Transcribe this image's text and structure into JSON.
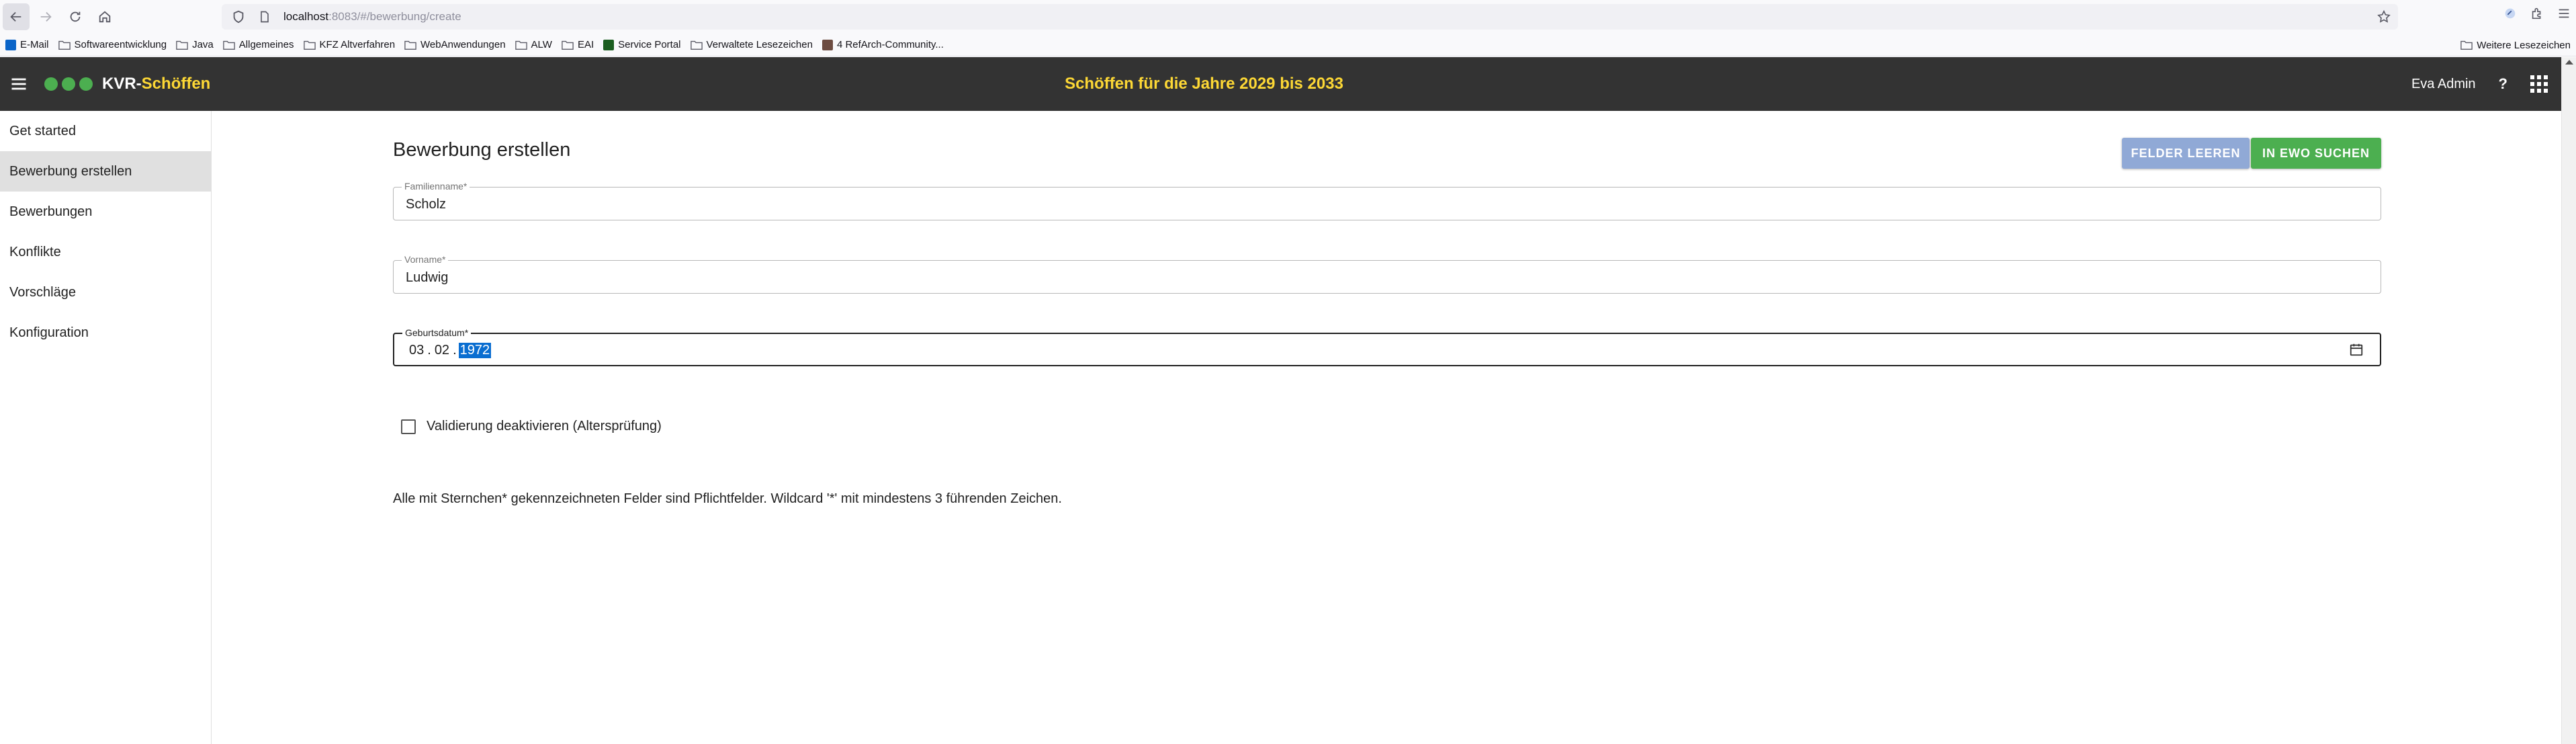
{
  "browser": {
    "url_host": "localhost",
    "url_rest": ":8083/#/bewerbung/create",
    "bookmarks": [
      {
        "label": "E-Mail",
        "type": "favicon",
        "color": "#0a64c8"
      },
      {
        "label": "Softwareentwicklung",
        "type": "folder"
      },
      {
        "label": "Java",
        "type": "folder"
      },
      {
        "label": "Allgemeines",
        "type": "folder"
      },
      {
        "label": "KFZ Altverfahren",
        "type": "folder"
      },
      {
        "label": "WebAnwendungen",
        "type": "folder"
      },
      {
        "label": "ALW",
        "type": "folder"
      },
      {
        "label": "EAI",
        "type": "folder"
      },
      {
        "label": "Service Portal",
        "type": "favicon",
        "color": "#1b5e20"
      },
      {
        "label": "Verwaltete Lesezeichen",
        "type": "folder"
      },
      {
        "label": "4 RefArch-Community...",
        "type": "favicon",
        "color": "#6d4c41"
      }
    ],
    "other_bookmarks": "Weitere Lesezeichen"
  },
  "header": {
    "brand_part1": "KVR-",
    "brand_part2": "Schöffen",
    "title": "Schöffen für die Jahre 2029 bis 2033",
    "user": "Eva Admin",
    "help": "?",
    "brand_dot_color": "#4caf50",
    "accent_color": "#fdd835",
    "bar_color": "#333333"
  },
  "sidebar": {
    "items": [
      {
        "label": "Get started",
        "active": false
      },
      {
        "label": "Bewerbung erstellen",
        "active": true
      },
      {
        "label": "Bewerbungen",
        "active": false
      },
      {
        "label": "Konflikte",
        "active": false
      },
      {
        "label": "Vorschläge",
        "active": false
      },
      {
        "label": "Konfiguration",
        "active": false
      }
    ]
  },
  "main": {
    "title": "Bewerbung erstellen",
    "btn_clear": "FELDER LEEREN",
    "btn_ewo": "IN EWO SUCHEN",
    "fields": {
      "familienname": {
        "label": "Familienname*",
        "value": "Scholz"
      },
      "vorname": {
        "label": "Vorname*",
        "value": "Ludwig"
      },
      "geburtsdatum": {
        "label": "Geburtsdatum*",
        "day": "03",
        "month": "02",
        "year": "1972"
      }
    },
    "checkbox_label": "Validierung deaktivieren (Altersprüfung)",
    "checkbox_checked": false,
    "hint": "Alle mit Sternchen* gekennzeichneten Felder sind Pflichtfelder. Wildcard '*' mit mindestens 3 führenden Zeichen."
  }
}
